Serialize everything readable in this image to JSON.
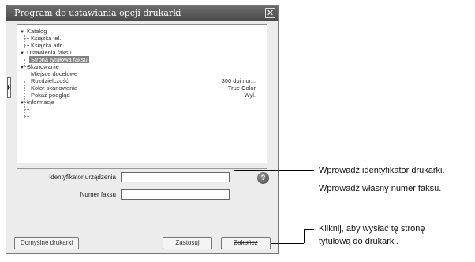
{
  "window": {
    "title": "Program do ustawiania opcji drukarki",
    "close_label": "✕"
  },
  "tree": {
    "items": [
      {
        "label": "Katalog",
        "expanded": true,
        "level": 0
      },
      {
        "label": "Książka tel.",
        "level": 1
      },
      {
        "label": "Książka adr.",
        "level": 1
      },
      {
        "label": "Ustawienia faksu",
        "expanded": true,
        "level": 0
      },
      {
        "label": "Strona tytułowa faksu",
        "level": 1,
        "selected": true
      },
      {
        "label": "Skanowanie",
        "expanded": true,
        "level": 0
      },
      {
        "label": "Miejsce docelowe",
        "level": 1
      },
      {
        "label": "Rozdzielczość",
        "value": "300 dpi nor...",
        "level": 1
      },
      {
        "label": "Kolor skanowania",
        "value": "True Color",
        "level": 1
      },
      {
        "label": "Pokaż podgląd",
        "value": "Wył.",
        "level": 1
      },
      {
        "label": "Informacje",
        "expanded": true,
        "level": 0
      }
    ]
  },
  "form": {
    "device_id_label": "Identyfikator urządzenia",
    "device_id_value": "",
    "fax_number_label": "Numer faksu",
    "fax_number_value": "",
    "help_label": "?"
  },
  "buttons": {
    "default_printers": "Domyślne drukarki",
    "apply": "Zastosuj",
    "close": "Zakończ"
  },
  "callouts": {
    "device_id": "Wprowadź identyfikator drukarki.",
    "fax_number": "Wprowadź własny numer faksu.",
    "send_line1": "Kliknij, aby wysłać tę stronę",
    "send_line2": "tytułową do drukarki."
  }
}
